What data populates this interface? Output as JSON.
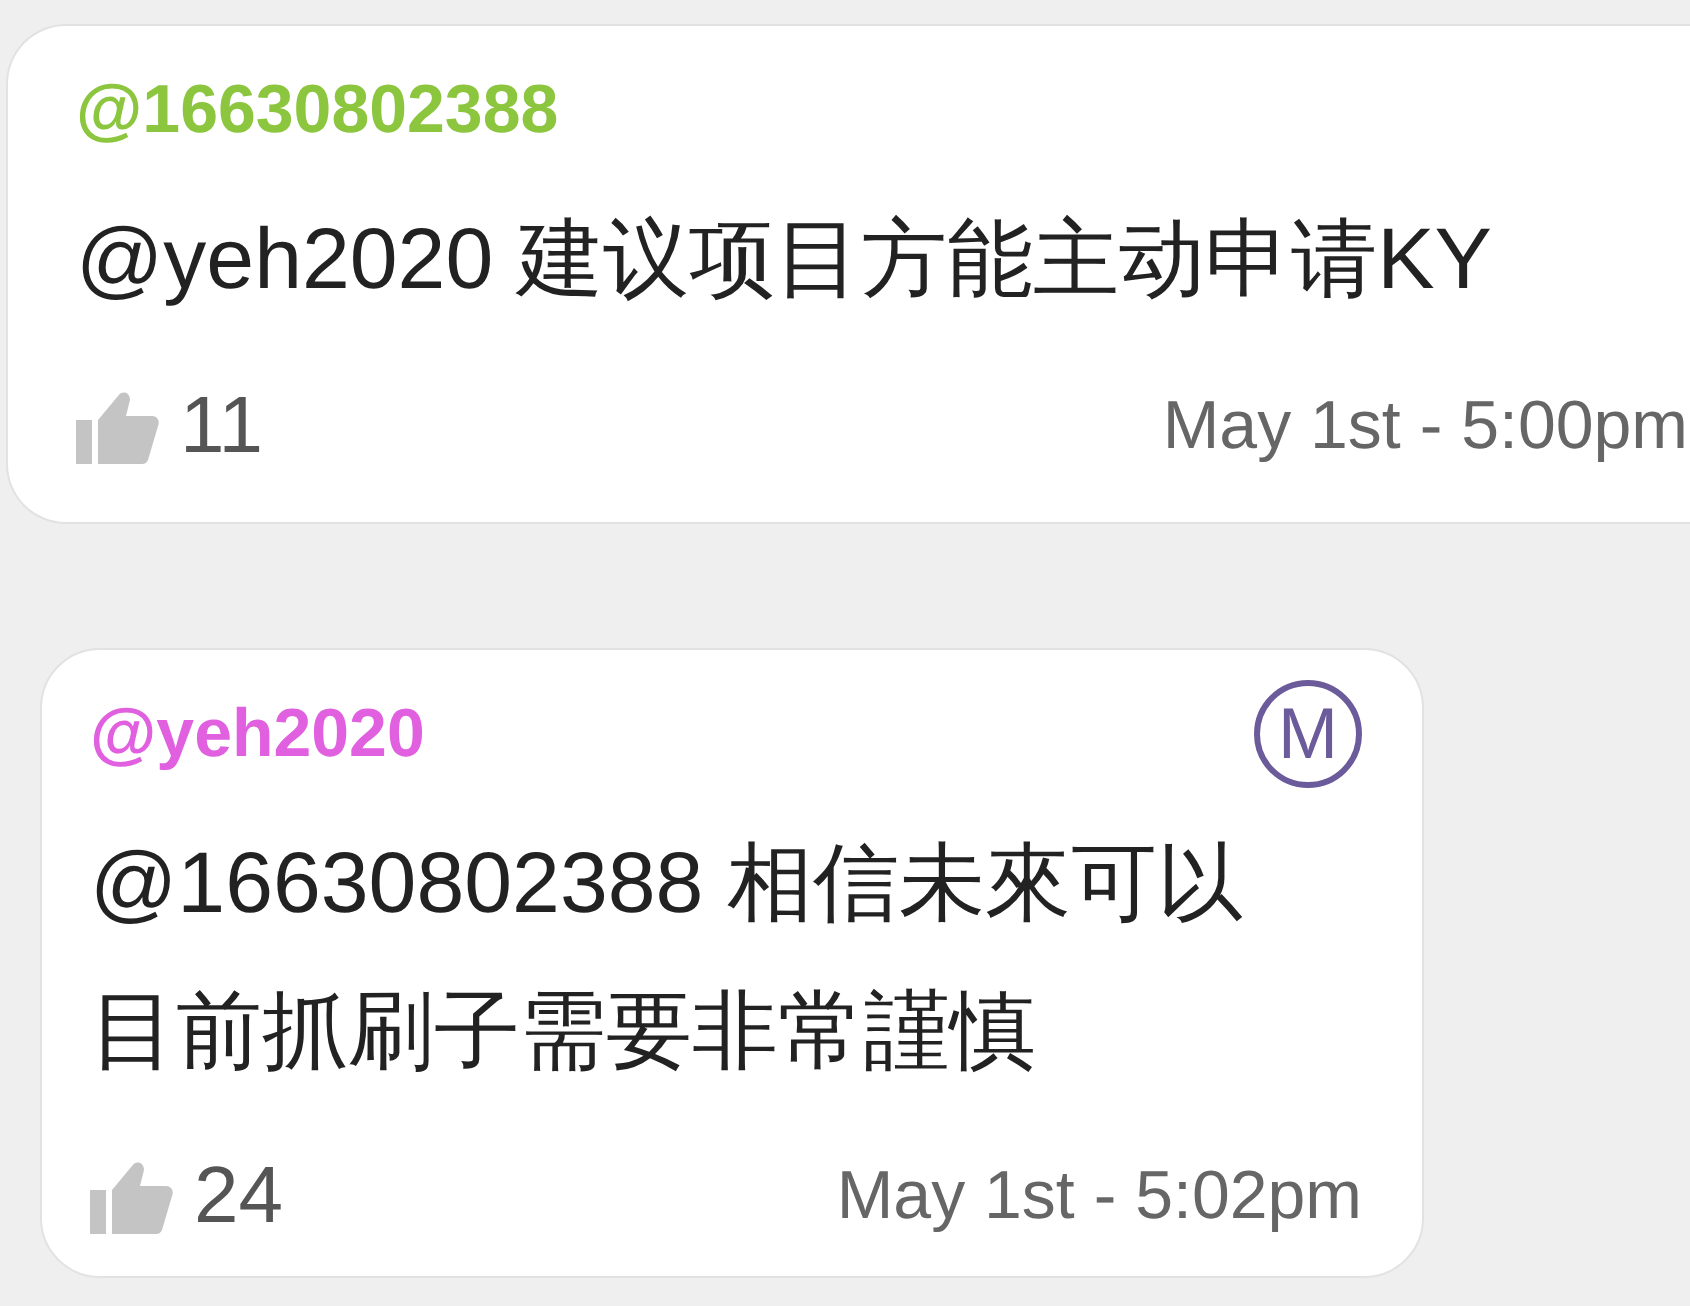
{
  "comments": [
    {
      "author": "@16630802388",
      "color": "#8cc63f",
      "lines": [
        "@yeh2020 建议项目方能主动申请KY"
      ],
      "likes": "11",
      "time": "May 1st - 5:00pm"
    },
    {
      "author": "@yeh2020",
      "color": "#e060e0",
      "badge": "M",
      "lines": [
        "@16630802388 相信未來可以",
        "目前抓刷子需要非常謹慎"
      ],
      "likes": "24",
      "time": "May 1st - 5:02pm"
    }
  ]
}
